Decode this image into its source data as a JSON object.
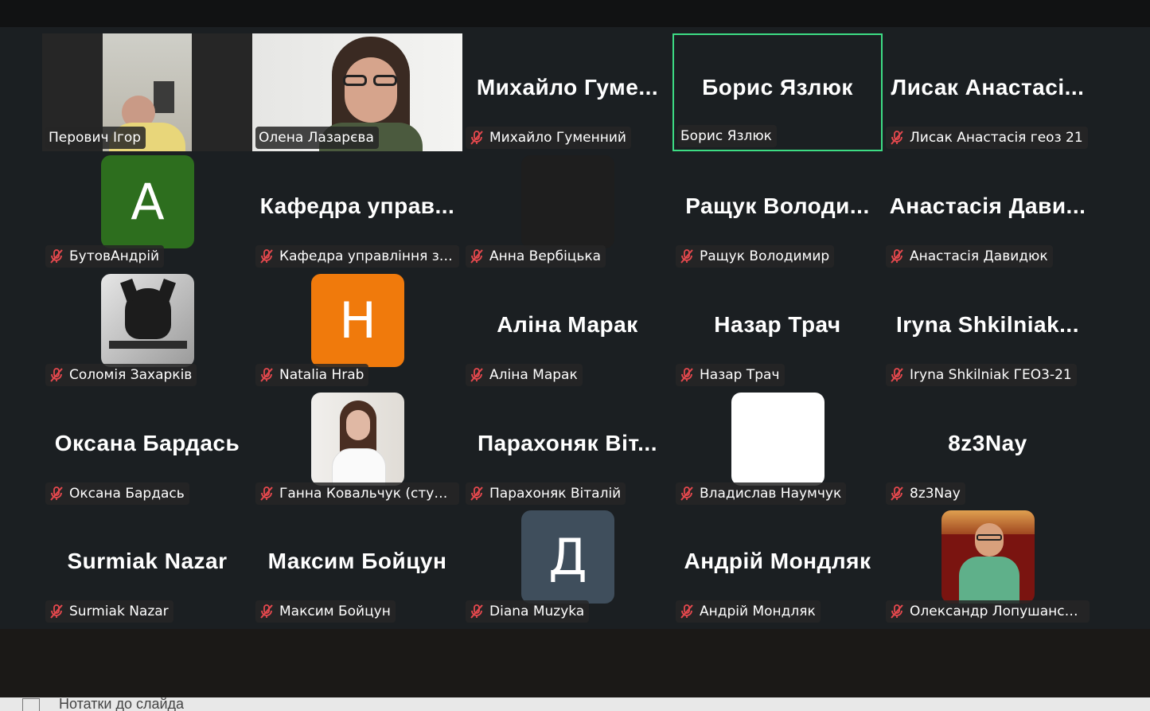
{
  "colors": {
    "active_speaker": "#3ddc84",
    "mute_icon": "#e5484d",
    "tile_bg": "#1b1f22",
    "label_bg": "#262626"
  },
  "participants": [
    {
      "display": "",
      "label": "Перович Ігор",
      "muted": false,
      "kind": "video-igor"
    },
    {
      "display": "",
      "label": "Олена Лазарєва",
      "muted": false,
      "kind": "video-olena"
    },
    {
      "display": "Михайло  Гуме...",
      "label": "Михайло Гуменний",
      "muted": true,
      "kind": "name"
    },
    {
      "display": "Борис Язлюк",
      "label": "Борис Язлюк",
      "muted": false,
      "kind": "name",
      "active": true
    },
    {
      "display": "Лисак  Анастасі...",
      "label": "Лисак Анастасія геоз 21",
      "muted": true,
      "kind": "name"
    },
    {
      "display": "A",
      "label": "БутовАндрій",
      "muted": true,
      "kind": "avatar",
      "avatar_color": "#2d6e1e"
    },
    {
      "display": "Кафедра  управ...",
      "label": "Кафедра управління зем...",
      "muted": true,
      "kind": "name"
    },
    {
      "display": "",
      "label": "Анна Вербіцька",
      "muted": true,
      "kind": "avatar",
      "avatar_color": "#1e1e1e"
    },
    {
      "display": "Ращук  Володи...",
      "label": "Ращук Володимир",
      "muted": true,
      "kind": "name"
    },
    {
      "display": "Анастасія  Дави...",
      "label": "Анастасія Давидюк",
      "muted": true,
      "kind": "name"
    },
    {
      "display": "",
      "label": "Соломія Захарків",
      "muted": true,
      "kind": "avatar-photo-dog"
    },
    {
      "display": "H",
      "label": "Natalia Hrab",
      "muted": true,
      "kind": "avatar",
      "avatar_color": "#f07a0c"
    },
    {
      "display": "Аліна Марак",
      "label": "Аліна Марак",
      "muted": true,
      "kind": "name"
    },
    {
      "display": "Назар Трач",
      "label": "Назар Трач",
      "muted": true,
      "kind": "name"
    },
    {
      "display": "Iryna  Shkilniak...",
      "label": "Iryna Shkilniak ГЕО3-21",
      "muted": true,
      "kind": "name"
    },
    {
      "display": "Оксана Бардась",
      "label": "Оксана Бардась",
      "muted": true,
      "kind": "name"
    },
    {
      "display": "",
      "label": "Ганна Ковальчук (студен...",
      "muted": true,
      "kind": "avatar-photo-woman"
    },
    {
      "display": "Парахоняк  Віт...",
      "label": "Парахоняк Віталій",
      "muted": true,
      "kind": "name"
    },
    {
      "display": "",
      "label": "Владислав Наумчук",
      "muted": true,
      "kind": "avatar",
      "avatar_color": "#ffffff"
    },
    {
      "display": "8z3Nay",
      "label": "8z3Nay",
      "muted": true,
      "kind": "name"
    },
    {
      "display": "Surmiak Nazar",
      "label": "Surmiak Nazar",
      "muted": true,
      "kind": "name"
    },
    {
      "display": "Максим Бойцун",
      "label": "Максим Бойцун",
      "muted": true,
      "kind": "name"
    },
    {
      "display": "Д",
      "label": "Diana Muzyka",
      "muted": true,
      "kind": "avatar",
      "avatar_color": "#3f4e5c"
    },
    {
      "display": "Андрій Мондляк",
      "label": "Андрій Мондляк",
      "muted": true,
      "kind": "name"
    },
    {
      "display": "",
      "label": "Олександр Лопушанськ...",
      "muted": true,
      "kind": "avatar-photo-man"
    }
  ],
  "notes": {
    "label": "Нотатки до слайда"
  }
}
